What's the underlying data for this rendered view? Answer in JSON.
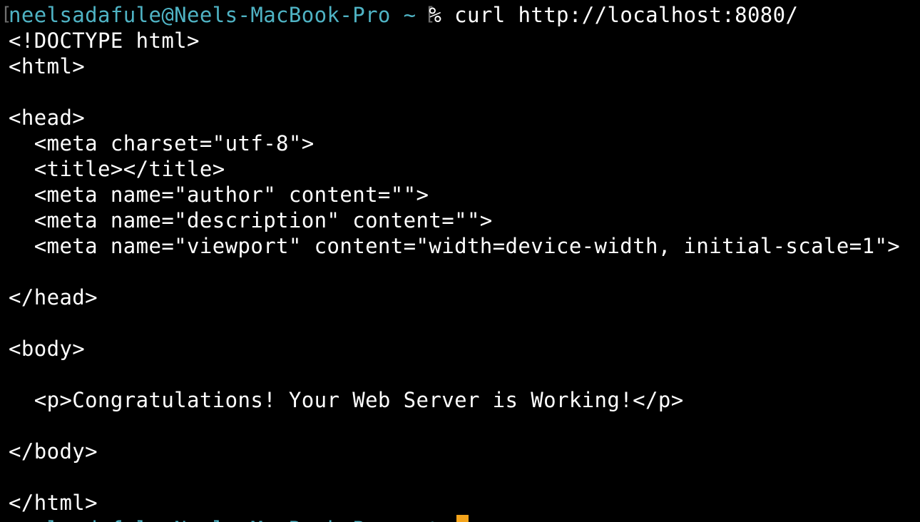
{
  "prompt": {
    "user_host": "neelsadafule@Neels-MacBook-Pro",
    "cwd": "~",
    "symbol": "%",
    "command": "curl http://localhost:8080/"
  },
  "output_lines": [
    "<!DOCTYPE html>",
    "<html>",
    "",
    "<head>",
    "  <meta charset=\"utf-8\">",
    "  <title></title>",
    "  <meta name=\"author\" content=\"\">",
    "  <meta name=\"description\" content=\"\">",
    "  <meta name=\"viewport\" content=\"width=device-width, initial-scale=1\">",
    "",
    "</head>",
    "",
    "<body>",
    "",
    "  <p>Congratulations! Your Web Server is Working!</p>",
    "",
    "</body>",
    "",
    "</html>"
  ],
  "next_prompt": "neelsadafule@Neels-MacBook-Pro ~ %",
  "colors": {
    "background": "#000000",
    "text": "#ffffff",
    "prompt": "#4fb3c4",
    "cursor": "#f4a41b"
  }
}
